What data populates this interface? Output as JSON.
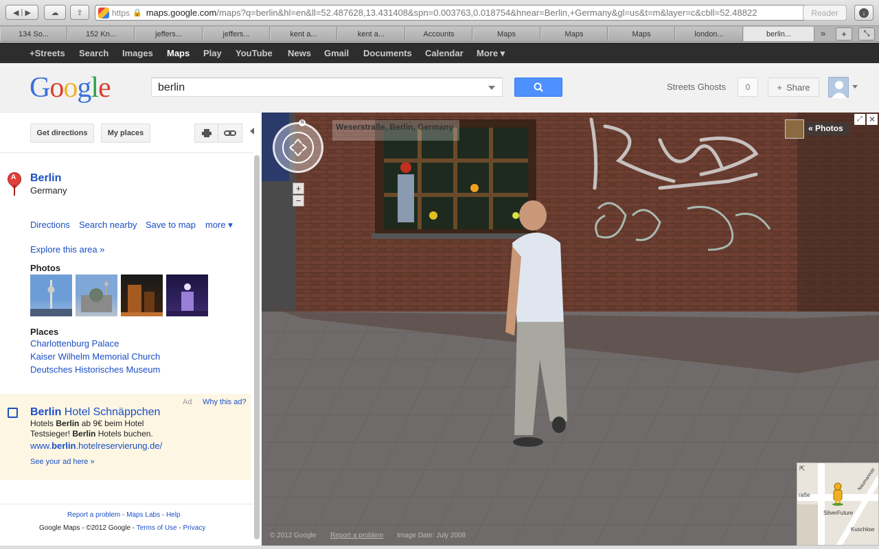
{
  "browser": {
    "https_label": "https",
    "url_host": "maps.google.com",
    "url_rest": "/maps?q=berlin&hl=en&ll=52.487628,13.431408&spn=0.003763,0.018754&hnear=Berlin,+Germany&gl=us&t=m&layer=c&cbll=52.48822",
    "reader_label": "Reader"
  },
  "tabs": [
    {
      "label": "134 So..."
    },
    {
      "label": "152 Kn..."
    },
    {
      "label": "jeffers..."
    },
    {
      "label": "jeffers..."
    },
    {
      "label": "kent a..."
    },
    {
      "label": "kent a..."
    },
    {
      "label": "Accounts"
    },
    {
      "label": "Maps"
    },
    {
      "label": "Maps"
    },
    {
      "label": "Maps"
    },
    {
      "label": "london..."
    },
    {
      "label": "berlin..."
    }
  ],
  "gbar": {
    "items": [
      "+Streets",
      "Search",
      "Images",
      "Maps",
      "Play",
      "YouTube",
      "News",
      "Gmail",
      "Documents",
      "Calendar",
      "More ▾"
    ],
    "selected": "Maps"
  },
  "header": {
    "search_value": "berlin",
    "user_link": "Streets Ghosts",
    "count": "0",
    "share_label": "Share"
  },
  "panel": {
    "get_directions": "Get directions",
    "my_places": "My places",
    "pin_letter": "A",
    "place_title": "Berlin",
    "place_subtitle": "Germany",
    "actions": [
      "Directions",
      "Search nearby",
      "Save to map",
      "more ▾"
    ],
    "explore": "Explore this area »",
    "photos_label": "Photos",
    "places_label": "Places",
    "places": [
      "Charlottenburg Palace",
      "Kaiser Wilhelm Memorial Church",
      "Deutsches Historisches Museum"
    ],
    "ad": {
      "label": "Ad",
      "why": "Why this ad?",
      "title_bold": "Berlin",
      "title_rest": " Hotel Schnäppchen",
      "body_1": "Hotels ",
      "body_bold_1": "Berlin",
      "body_2": " ab 9€ beim Hotel Testsieger! ",
      "body_bold_2": "Berlin",
      "body_3": " Hotels buchen.",
      "url_1": "www.",
      "url_bold": "berlin",
      "url_2": ".hotelreservierung.de/",
      "see": "See your ad here »"
    },
    "footer_links": "Report a problem - Maps Labs - Help",
    "footer_copy_1": "Google Maps - ©2012 Google - ",
    "footer_terms": "Terms of Use",
    "footer_sep": " - ",
    "footer_privacy": "Privacy"
  },
  "streetview": {
    "address": "Weserstraße, Berlin, Germany",
    "photos_label": "« Photos",
    "compass_n": "N",
    "zoom_in": "+",
    "zoom_out": "−",
    "copyright": "© 2012 Google",
    "report": "Report a problem",
    "image_date": "Image Date: July 2008",
    "minimap_labels": [
      "raße",
      "SilverFuture",
      "Kuschlow",
      "Naumannstr"
    ]
  }
}
